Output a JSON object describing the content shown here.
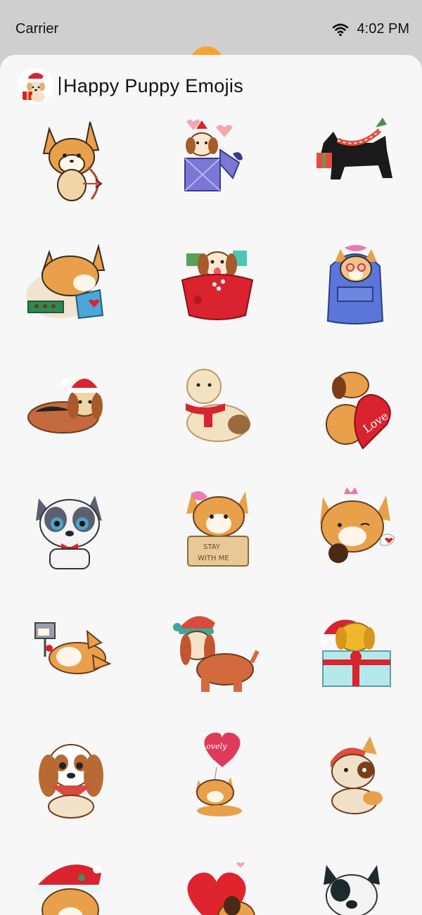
{
  "status": {
    "carrier": "Carrier",
    "time": "4:02 PM"
  },
  "app": {
    "title": "Happy Puppy Emojis"
  },
  "colors": {
    "accent": "#f7a22a",
    "sheet": "#f7f7f7",
    "status_bg": "#cfcfcf"
  },
  "stickers": [
    {
      "name": "corgi-cupid-sticker"
    },
    {
      "name": "beagle-gift-box-sticker"
    },
    {
      "name": "scottie-scarf-sticker"
    },
    {
      "name": "corgi-chocolates-sticker"
    },
    {
      "name": "beagle-santa-sack-sticker"
    },
    {
      "name": "corgi-backpack-sticker"
    },
    {
      "name": "basset-santa-hat-sticker"
    },
    {
      "name": "poodle-scarf-sticker"
    },
    {
      "name": "dog-love-heart-sticker"
    },
    {
      "name": "french-bulldog-bowtie-sticker"
    },
    {
      "name": "corgi-stay-with-me-sticker"
    },
    {
      "name": "corgi-chocolate-wink-sticker"
    },
    {
      "name": "corgi-mailbox-sticker"
    },
    {
      "name": "spaniel-winter-hat-sticker"
    },
    {
      "name": "puppy-present-box-sticker"
    },
    {
      "name": "cavalier-bandana-sticker"
    },
    {
      "name": "corgi-lovely-balloon-sticker"
    },
    {
      "name": "corgi-beanie-sticker"
    },
    {
      "name": "corgi-santa-hat-sticker"
    },
    {
      "name": "heart-puppy-sticker"
    },
    {
      "name": "bulldog-sweater-sticker"
    }
  ]
}
